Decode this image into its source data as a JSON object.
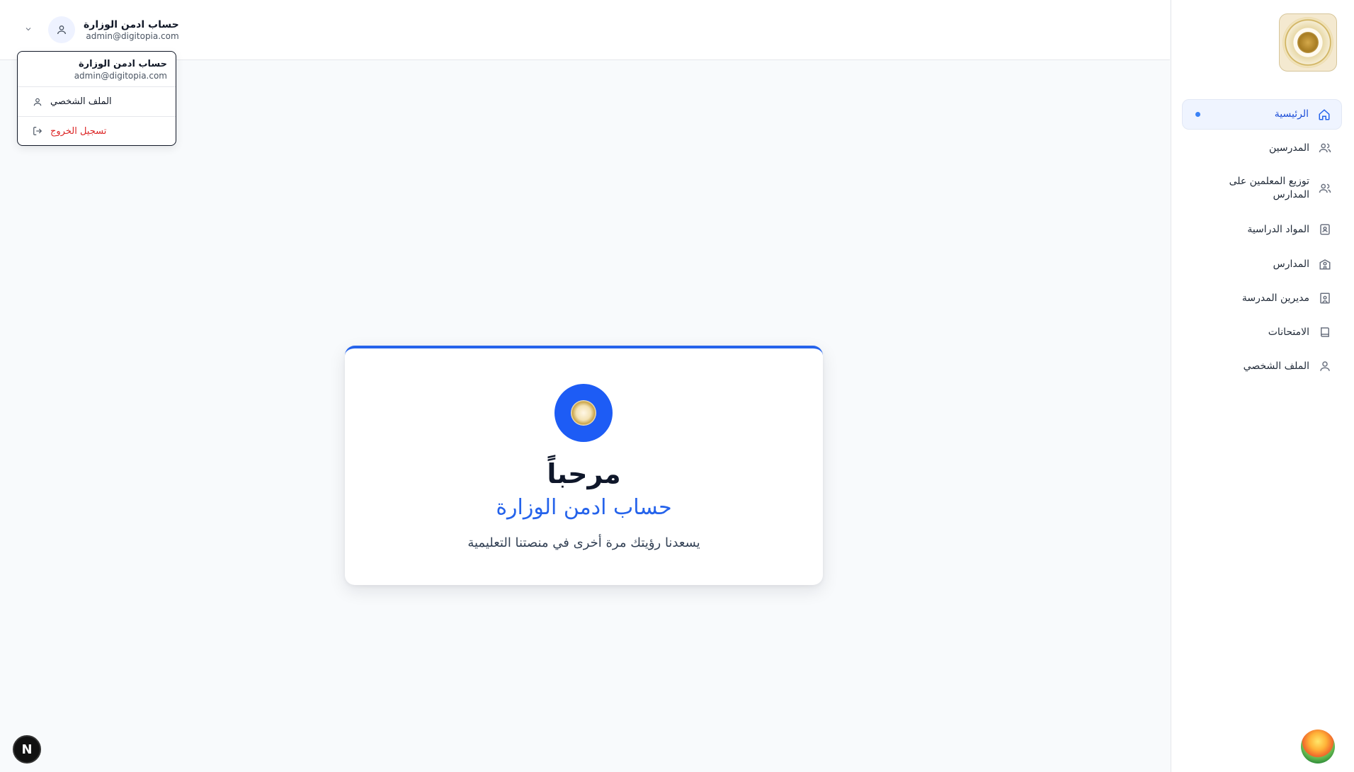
{
  "user": {
    "name": "حساب ادمن الوزارة",
    "email": "admin@digitopia.com"
  },
  "dropdown": {
    "name": "حساب ادمن الوزارة",
    "email": "admin@digitopia.com",
    "profile_label": "الملف الشخصي",
    "logout_label": "تسجيل الخروج"
  },
  "sidebar": {
    "items": [
      {
        "label": "الرئيسية",
        "icon": "home-icon",
        "active": true
      },
      {
        "label": "المدرسين",
        "icon": "users-icon"
      },
      {
        "label": "توزيع المعلمين على المدارس",
        "icon": "users-icon"
      },
      {
        "label": "المواد الدراسية",
        "icon": "book-user-icon"
      },
      {
        "label": "المدارس",
        "icon": "school-icon"
      },
      {
        "label": "مديرين المدرسة",
        "icon": "building-user-icon"
      },
      {
        "label": "الامتحانات",
        "icon": "book-icon"
      },
      {
        "label": "الملف الشخصي",
        "icon": "user-icon"
      }
    ]
  },
  "welcome": {
    "title": "مرحباً",
    "subtitle": "حساب ادمن الوزارة",
    "message": "يسعدنا رؤيتك مرة أخرى في منصتنا التعليمية"
  },
  "badge": {
    "letter": "N"
  },
  "colors": {
    "accent": "#2563eb",
    "logout": "#dc2626",
    "active_bg": "#eff4ff"
  }
}
